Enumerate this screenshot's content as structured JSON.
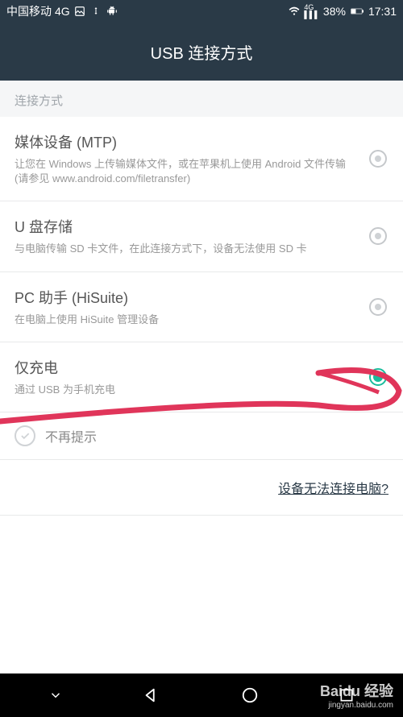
{
  "status_bar": {
    "carrier": "中国移动",
    "network": "4G",
    "battery_pct": "38%",
    "time": "17:31"
  },
  "header": {
    "title": "USB 连接方式"
  },
  "section_label": "连接方式",
  "options": [
    {
      "title": "媒体设备 (MTP)",
      "desc": "让您在 Windows 上传输媒体文件，或在苹果机上使用 Android 文件传输 (请参见 www.android.com/filetransfer)",
      "selected": false
    },
    {
      "title": "U 盘存储",
      "desc": "与电脑传输 SD 卡文件，在此连接方式下，设备无法使用 SD 卡",
      "selected": false
    },
    {
      "title": "PC 助手 (HiSuite)",
      "desc": "在电脑上使用 HiSuite 管理设备",
      "selected": false
    },
    {
      "title": "仅充电",
      "desc": "通过 USB 为手机充电",
      "selected": true
    }
  ],
  "dont_show_again": "不再提示",
  "help_link": "设备无法连接电脑?",
  "watermark": {
    "brand": "Baidu 经验",
    "url": "jingyan.baidu.com"
  }
}
